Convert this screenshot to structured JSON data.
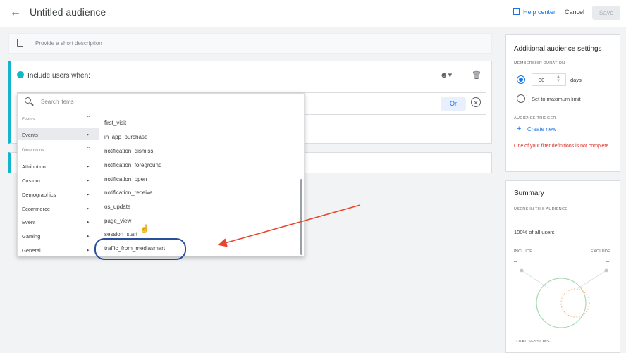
{
  "header": {
    "back_icon": "arrow-left-icon",
    "title": "Untitled audience",
    "help_label": "Help center",
    "cancel_label": "Cancel",
    "save_label": "Save"
  },
  "description": {
    "placeholder": "Provide a short description"
  },
  "condition": {
    "label": "Include users when:",
    "or_label": "Or"
  },
  "search": {
    "placeholder": "Search items"
  },
  "categories": {
    "events_header": "Events",
    "events_item": "Events",
    "dimensions_header": "Dimensions",
    "dimensions": [
      "Attribution",
      "Custom",
      "Demographics",
      "Ecommerce",
      "Event",
      "Gaming",
      "General"
    ]
  },
  "events": [
    "first_visit",
    "in_app_purchase",
    "notification_dismiss",
    "notification_foreground",
    "notification_open",
    "notification_receive",
    "os_update",
    "page_view",
    "session_start",
    "traffic_from_mediasmart"
  ],
  "additional": {
    "title": "Additional audience settings",
    "membership_caption": "MEMBERSHIP DURATION",
    "duration_value": "30",
    "days_label": "days",
    "max_label": "Set to maximum limit",
    "trigger_caption": "AUDIENCE TRIGGER",
    "create_label": "Create new",
    "error_text": "One of your filter definitions is not complete."
  },
  "summary": {
    "title": "Summary",
    "users_caption": "USERS IN THIS AUDIENCE",
    "users_value": "–",
    "pct_text": "100% of all users",
    "include_label": "INCLUDE",
    "exclude_label": "EXCLUDE",
    "include_value": "–",
    "exclude_value": "–",
    "sessions_caption": "TOTAL SESSIONS"
  },
  "colors": {
    "accent": "#1a73e8",
    "teal": "#12b5cb",
    "error": "#d93025",
    "annotation_arrow": "#e8452c",
    "annotation_circle": "#2a4d9c"
  }
}
